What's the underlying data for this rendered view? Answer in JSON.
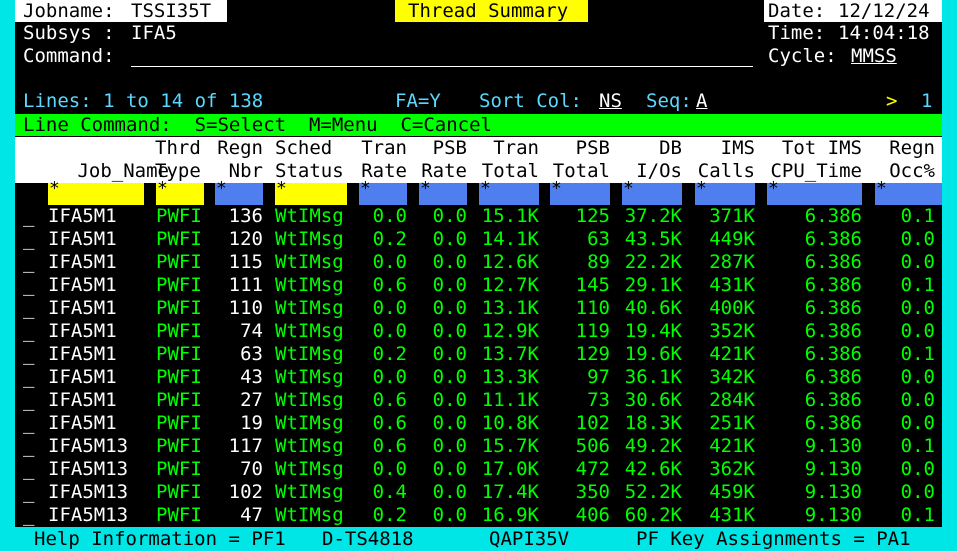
{
  "header": {
    "jobname_label": "Jobname:",
    "jobname_value": "TSSI35T",
    "title": "Thread Summary",
    "date_label": "Date:",
    "date_value": "12/12/24",
    "subsys_label": "Subsys :",
    "subsys_value": "IFA5",
    "time_label": "Time:",
    "time_value": "14:04:18",
    "command_label": "Command:",
    "command_value": "",
    "cycle_label": "Cycle:",
    "cycle_value": "MMSS"
  },
  "status": {
    "lines": "Lines: 1 to 14 of 138",
    "fa": "FA=Y",
    "sort_label": "Sort Col:",
    "sort_value": "NS",
    "seq_label": "Seq:",
    "seq_value": "A",
    "scroll_arrow": ">",
    "scroll_value": "1"
  },
  "line_command": "Line Command:  S=Select  M=Menu  C=Cancel",
  "columns": [
    {
      "top": "",
      "bottom": "Job_Name"
    },
    {
      "top": "Thrd",
      "bottom": "Type"
    },
    {
      "top": "Regn",
      "bottom": "Nbr"
    },
    {
      "top": "Sched",
      "bottom": "Status"
    },
    {
      "top": "Tran",
      "bottom": "Rate"
    },
    {
      "top": "PSB",
      "bottom": "Rate"
    },
    {
      "top": "Tran",
      "bottom": "Total"
    },
    {
      "top": "PSB",
      "bottom": "Total"
    },
    {
      "top": "DB",
      "bottom": "I/Os"
    },
    {
      "top": "IMS",
      "bottom": "Calls"
    },
    {
      "top": "Tot IMS",
      "bottom": "CPU_Time"
    },
    {
      "top": "Regn",
      "bottom": "Occ%"
    }
  ],
  "filter_symbol": "*",
  "rows": [
    [
      "IFA5M1",
      "PWFI",
      "136",
      "WtIMsg",
      "0.0",
      "0.0",
      "15.1K",
      "125",
      "37.2K",
      "371K",
      "6.386",
      "0.1"
    ],
    [
      "IFA5M1",
      "PWFI",
      "120",
      "WtIMsg",
      "0.2",
      "0.0",
      "14.1K",
      "63",
      "43.5K",
      "449K",
      "6.386",
      "0.0"
    ],
    [
      "IFA5M1",
      "PWFI",
      "115",
      "WtIMsg",
      "0.0",
      "0.0",
      "12.6K",
      "89",
      "22.2K",
      "287K",
      "6.386",
      "0.0"
    ],
    [
      "IFA5M1",
      "PWFI",
      "111",
      "WtIMsg",
      "0.6",
      "0.0",
      "12.7K",
      "145",
      "29.1K",
      "431K",
      "6.386",
      "0.1"
    ],
    [
      "IFA5M1",
      "PWFI",
      "110",
      "WtIMsg",
      "0.0",
      "0.0",
      "13.1K",
      "110",
      "40.6K",
      "400K",
      "6.386",
      "0.0"
    ],
    [
      "IFA5M1",
      "PWFI",
      "74",
      "WtIMsg",
      "0.0",
      "0.0",
      "12.9K",
      "119",
      "19.4K",
      "352K",
      "6.386",
      "0.0"
    ],
    [
      "IFA5M1",
      "PWFI",
      "63",
      "WtIMsg",
      "0.2",
      "0.0",
      "13.7K",
      "129",
      "19.6K",
      "421K",
      "6.386",
      "0.1"
    ],
    [
      "IFA5M1",
      "PWFI",
      "43",
      "WtIMsg",
      "0.0",
      "0.0",
      "13.3K",
      "97",
      "36.1K",
      "342K",
      "6.386",
      "0.0"
    ],
    [
      "IFA5M1",
      "PWFI",
      "27",
      "WtIMsg",
      "0.6",
      "0.0",
      "11.1K",
      "73",
      "30.6K",
      "284K",
      "6.386",
      "0.0"
    ],
    [
      "IFA5M1",
      "PWFI",
      "19",
      "WtIMsg",
      "0.6",
      "0.0",
      "10.8K",
      "102",
      "18.3K",
      "251K",
      "6.386",
      "0.0"
    ],
    [
      "IFA5M13",
      "PWFI",
      "117",
      "WtIMsg",
      "0.6",
      "0.0",
      "15.7K",
      "506",
      "49.2K",
      "421K",
      "9.130",
      "0.1"
    ],
    [
      "IFA5M13",
      "PWFI",
      "70",
      "WtIMsg",
      "0.0",
      "0.0",
      "17.0K",
      "472",
      "42.6K",
      "362K",
      "9.130",
      "0.0"
    ],
    [
      "IFA5M13",
      "PWFI",
      "102",
      "WtIMsg",
      "0.4",
      "0.0",
      "17.4K",
      "350",
      "52.2K",
      "459K",
      "9.130",
      "0.0"
    ],
    [
      "IFA5M13",
      "PWFI",
      "47",
      "WtIMsg",
      "0.2",
      "0.0",
      "16.9K",
      "406",
      "60.2K",
      "431K",
      "9.130",
      "0.1"
    ]
  ],
  "footer": {
    "help": "Help Information = PF1",
    "panel_id": "D-TS4818",
    "api": "QAPI35V",
    "pf": "PF Key Assignments = PA1"
  },
  "colors": {
    "background": "#000000",
    "frame": "#00e5e5",
    "data_green": "#00ff00",
    "title_yellow": "#ffff00",
    "status_cyan": "#5ad8ff",
    "filter_blue": "#4f7fef"
  }
}
